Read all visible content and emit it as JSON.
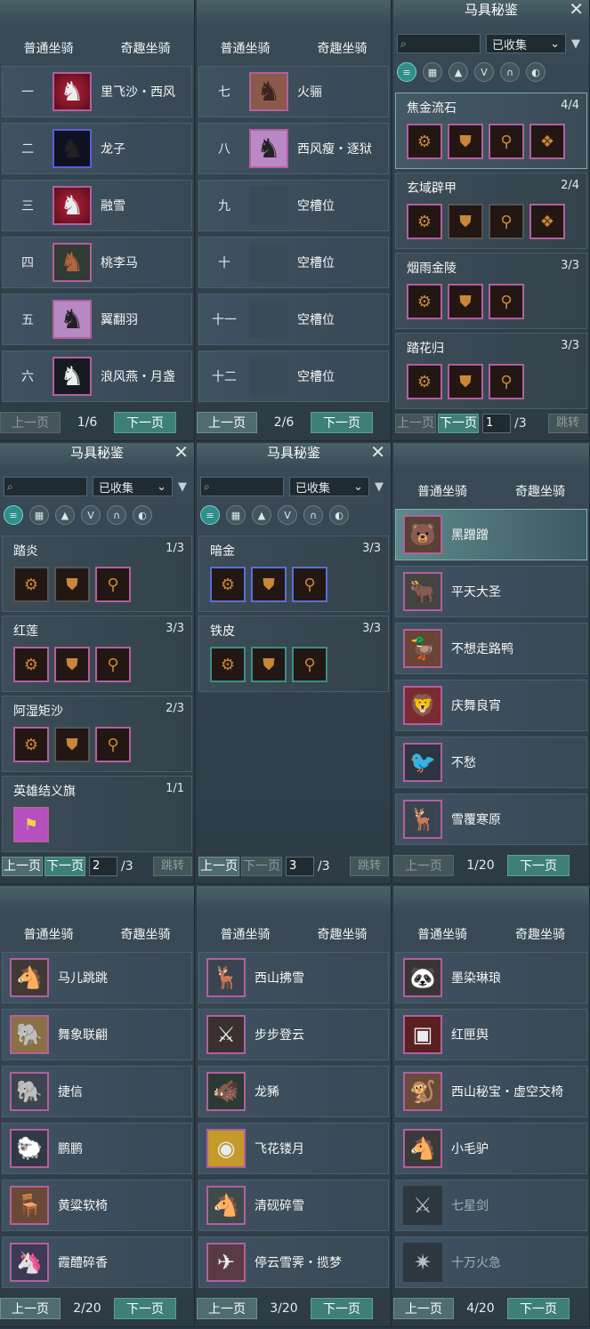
{
  "tabs": {
    "normal": "普通坐骑",
    "fun": "奇趣坐骑"
  },
  "pager": {
    "prev": "上一页",
    "next": "下一页",
    "jump": "跳转"
  },
  "p1": {
    "rows": [
      {
        "num": "一",
        "name": "里飞沙・西风",
        "icon": "horse-icon",
        "tone": "red"
      },
      {
        "num": "二",
        "name": "龙子",
        "icon": "horse-icon",
        "tone": "blue"
      },
      {
        "num": "三",
        "name": "融雪",
        "icon": "horse-icon",
        "tone": "red"
      },
      {
        "num": "四",
        "name": "桃李马",
        "icon": "horse-icon",
        "tone": "dark"
      },
      {
        "num": "五",
        "name": "翼翻羽",
        "icon": "horse-icon",
        "tone": "dark"
      },
      {
        "num": "六",
        "name": "浪风燕・月盏",
        "icon": "horse-icon",
        "tone": "dark"
      }
    ],
    "page": "1/6"
  },
  "p2": {
    "rows": [
      {
        "num": "七",
        "name": "火骊"
      },
      {
        "num": "八",
        "name": "西风瘦・逐狱"
      },
      {
        "num": "九",
        "name": "空槽位"
      },
      {
        "num": "十",
        "name": "空槽位"
      },
      {
        "num": "十一",
        "name": "空槽位"
      },
      {
        "num": "十二",
        "name": "空槽位"
      }
    ],
    "page": "2/6"
  },
  "p3": {
    "title": "马具秘鉴",
    "filter": "已收集",
    "sets": [
      {
        "name": "焦金流石",
        "count": "4/4"
      },
      {
        "name": "玄域辟甲",
        "count": "2/4"
      },
      {
        "name": "烟雨金陵",
        "count": "3/3"
      },
      {
        "name": "踏花归",
        "count": "3/3"
      }
    ],
    "page_input": "1",
    "page_total": "/3"
  },
  "p4": {
    "title": "马具秘鉴",
    "filter": "已收集",
    "sets": [
      {
        "name": "踏炎",
        "count": "1/3"
      },
      {
        "name": "红莲",
        "count": "3/3"
      },
      {
        "name": "阿湿矩沙",
        "count": "2/3"
      },
      {
        "name": "英雄结义旗",
        "count": "1/1"
      }
    ],
    "page_input": "2",
    "page_total": "/3"
  },
  "p5": {
    "title": "马具秘鉴",
    "filter": "已收集",
    "sets": [
      {
        "name": "暗金",
        "count": "3/3"
      },
      {
        "name": "铁皮",
        "count": "3/3"
      }
    ],
    "page_input": "3",
    "page_total": "/3"
  },
  "p6": {
    "rows": [
      {
        "name": "黑蹭蹭"
      },
      {
        "name": "平天大圣"
      },
      {
        "name": "不想走路鸭"
      },
      {
        "name": "庆舞良宵"
      },
      {
        "name": "不愁"
      },
      {
        "name": "雪覆寒原"
      }
    ],
    "page": "1/20"
  },
  "p7": {
    "rows": [
      {
        "name": "马儿跳跳"
      },
      {
        "name": "舞象联翩"
      },
      {
        "name": "捷信"
      },
      {
        "name": "鹏鹏"
      },
      {
        "name": "黄粱软椅"
      },
      {
        "name": "霞醴碎香"
      }
    ],
    "page": "2/20"
  },
  "p8": {
    "rows": [
      {
        "name": "西山拂雪"
      },
      {
        "name": "步步登云"
      },
      {
        "name": "龙豨"
      },
      {
        "name": "飞花镂月"
      },
      {
        "name": "清砚碎雪"
      },
      {
        "name": "停云雪霁・揽梦"
      }
    ],
    "page": "3/20"
  },
  "p9": {
    "rows": [
      {
        "name": "墨染琳琅"
      },
      {
        "name": "红匣舆"
      },
      {
        "name": "西山秘宝・虚空交椅"
      },
      {
        "name": "小毛驴"
      },
      {
        "name": "七星剑"
      },
      {
        "name": "十万火急"
      }
    ],
    "page": "4/20"
  }
}
